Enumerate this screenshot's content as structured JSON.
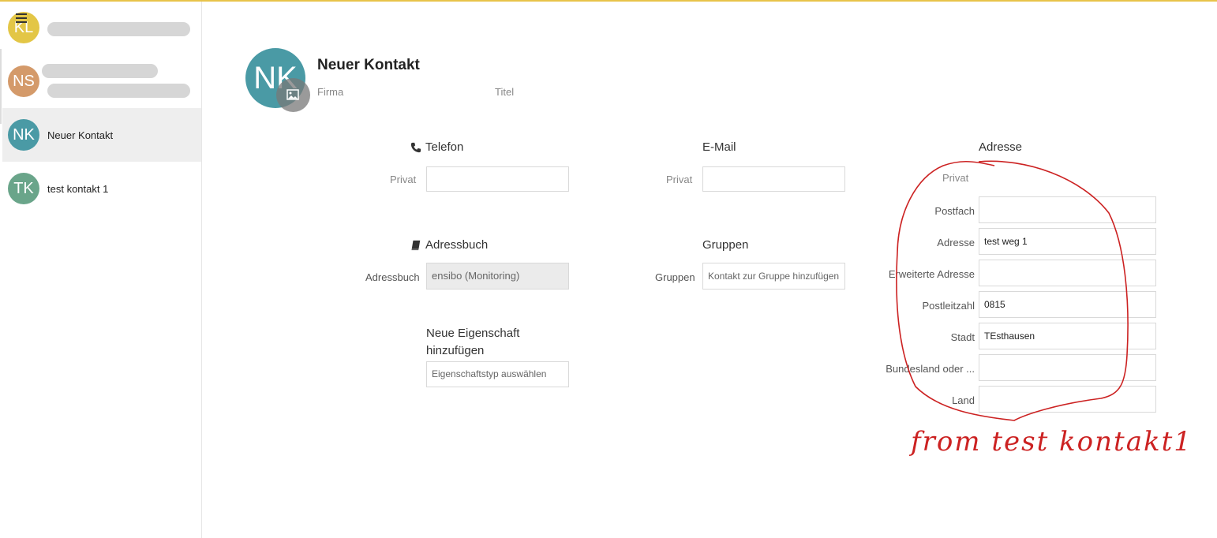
{
  "sidebar": {
    "items": [
      {
        "initials": "KL",
        "name": "",
        "color": "#e3c646"
      },
      {
        "initials": "NS",
        "name": "",
        "color": "#d49a6a"
      },
      {
        "initials": "NK",
        "name": "Neuer Kontakt",
        "color": "#4a9aa5",
        "active": true
      },
      {
        "initials": "TK",
        "name": "test kontakt 1",
        "color": "#6aa58a"
      }
    ]
  },
  "header": {
    "initials": "NK",
    "title": "Neuer Kontakt",
    "firma_placeholder": "Firma",
    "titel_placeholder": "Titel"
  },
  "telefon": {
    "heading": "Telefon",
    "label": "Privat",
    "value": ""
  },
  "email": {
    "heading": "E-Mail",
    "label": "Privat",
    "value": ""
  },
  "adressbuch": {
    "heading": "Adressbuch",
    "label": "Adressbuch",
    "value": "ensibo (Monitoring)"
  },
  "gruppen": {
    "heading": "Gruppen",
    "label": "Gruppen",
    "placeholder": "Kontakt zur Gruppe hinzufügen"
  },
  "neue_eigenschaft": {
    "heading_line1": "Neue Eigenschaft",
    "heading_line2": "hinzufügen",
    "placeholder": "Eigenschaftstyp auswählen"
  },
  "adresse": {
    "heading": "Adresse",
    "type_label": "Privat",
    "fields": [
      {
        "label": "Postfach",
        "value": ""
      },
      {
        "label": "Adresse",
        "value": "test weg 1"
      },
      {
        "label": "Erweiterte Adresse",
        "value": ""
      },
      {
        "label": "Postleitzahl",
        "value": "0815"
      },
      {
        "label": "Stadt",
        "value": "TEsthausen"
      },
      {
        "label": "Bundesland oder ...",
        "value": ""
      },
      {
        "label": "Land",
        "value": ""
      }
    ]
  },
  "annotation": {
    "text": "from test kontakt1",
    "color": "#cc2222"
  }
}
